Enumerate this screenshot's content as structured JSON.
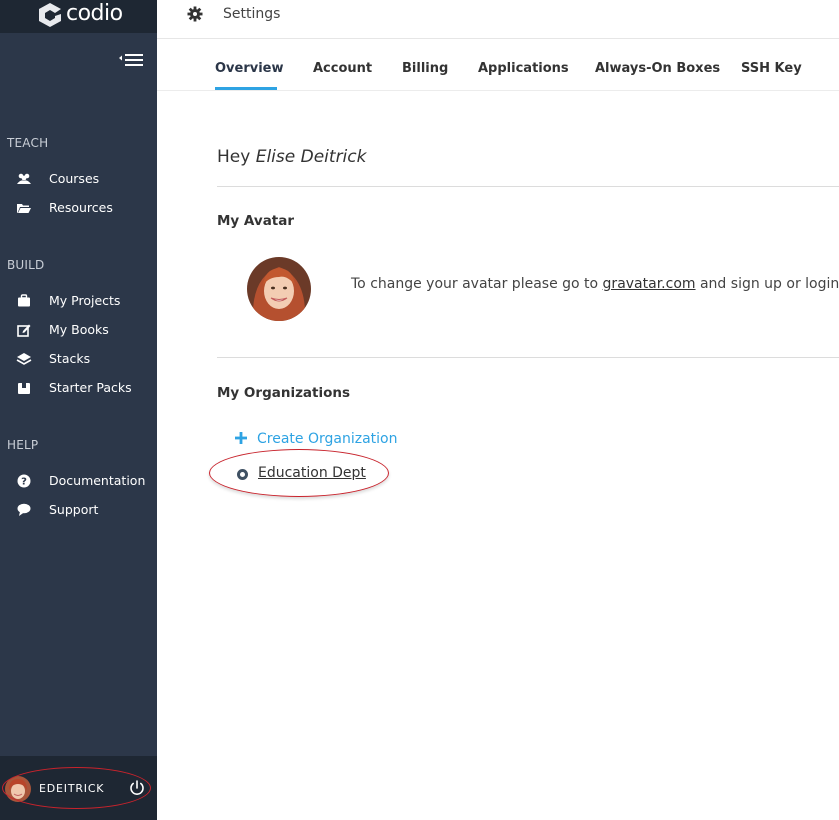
{
  "brand": {
    "name": "codio"
  },
  "sidebar": {
    "sections": [
      {
        "title": "TEACH",
        "items": [
          {
            "label": "Courses",
            "icon": "users-icon"
          },
          {
            "label": "Resources",
            "icon": "folder-open-icon"
          }
        ]
      },
      {
        "title": "BUILD",
        "items": [
          {
            "label": "My Projects",
            "icon": "briefcase-icon"
          },
          {
            "label": "My Books",
            "icon": "edit-icon"
          },
          {
            "label": "Stacks",
            "icon": "layers-icon"
          },
          {
            "label": "Starter Packs",
            "icon": "package-icon"
          }
        ]
      },
      {
        "title": "HELP",
        "items": [
          {
            "label": "Documentation",
            "icon": "question-circle-icon"
          },
          {
            "label": "Support",
            "icon": "chat-bubble-icon"
          }
        ]
      }
    ],
    "user": {
      "username": "EDEITRICK"
    }
  },
  "header": {
    "title": "Settings"
  },
  "tabs": [
    {
      "label": "Overview",
      "active": true
    },
    {
      "label": "Account",
      "active": false
    },
    {
      "label": "Billing",
      "active": false
    },
    {
      "label": "Applications",
      "active": false
    },
    {
      "label": "Always-On Boxes",
      "active": false
    },
    {
      "label": "SSH Key",
      "active": false
    }
  ],
  "main": {
    "greeting_prefix": "Hey",
    "user_full_name": "Elise Deitrick",
    "avatar_heading": "My Avatar",
    "avatar_text_before": "To change your avatar please go to ",
    "avatar_link": "gravatar.com",
    "avatar_text_after": " and sign up or login with",
    "orgs_heading": "My Organizations",
    "create_org_label": "Create Organization",
    "organizations": [
      {
        "name": "Education Dept"
      }
    ]
  },
  "colors": {
    "sidebar_bg": "#2c3749",
    "sidebar_dark": "#1e2733",
    "accent_blue": "#2ea3e3",
    "highlight_red": "#c8232c"
  }
}
